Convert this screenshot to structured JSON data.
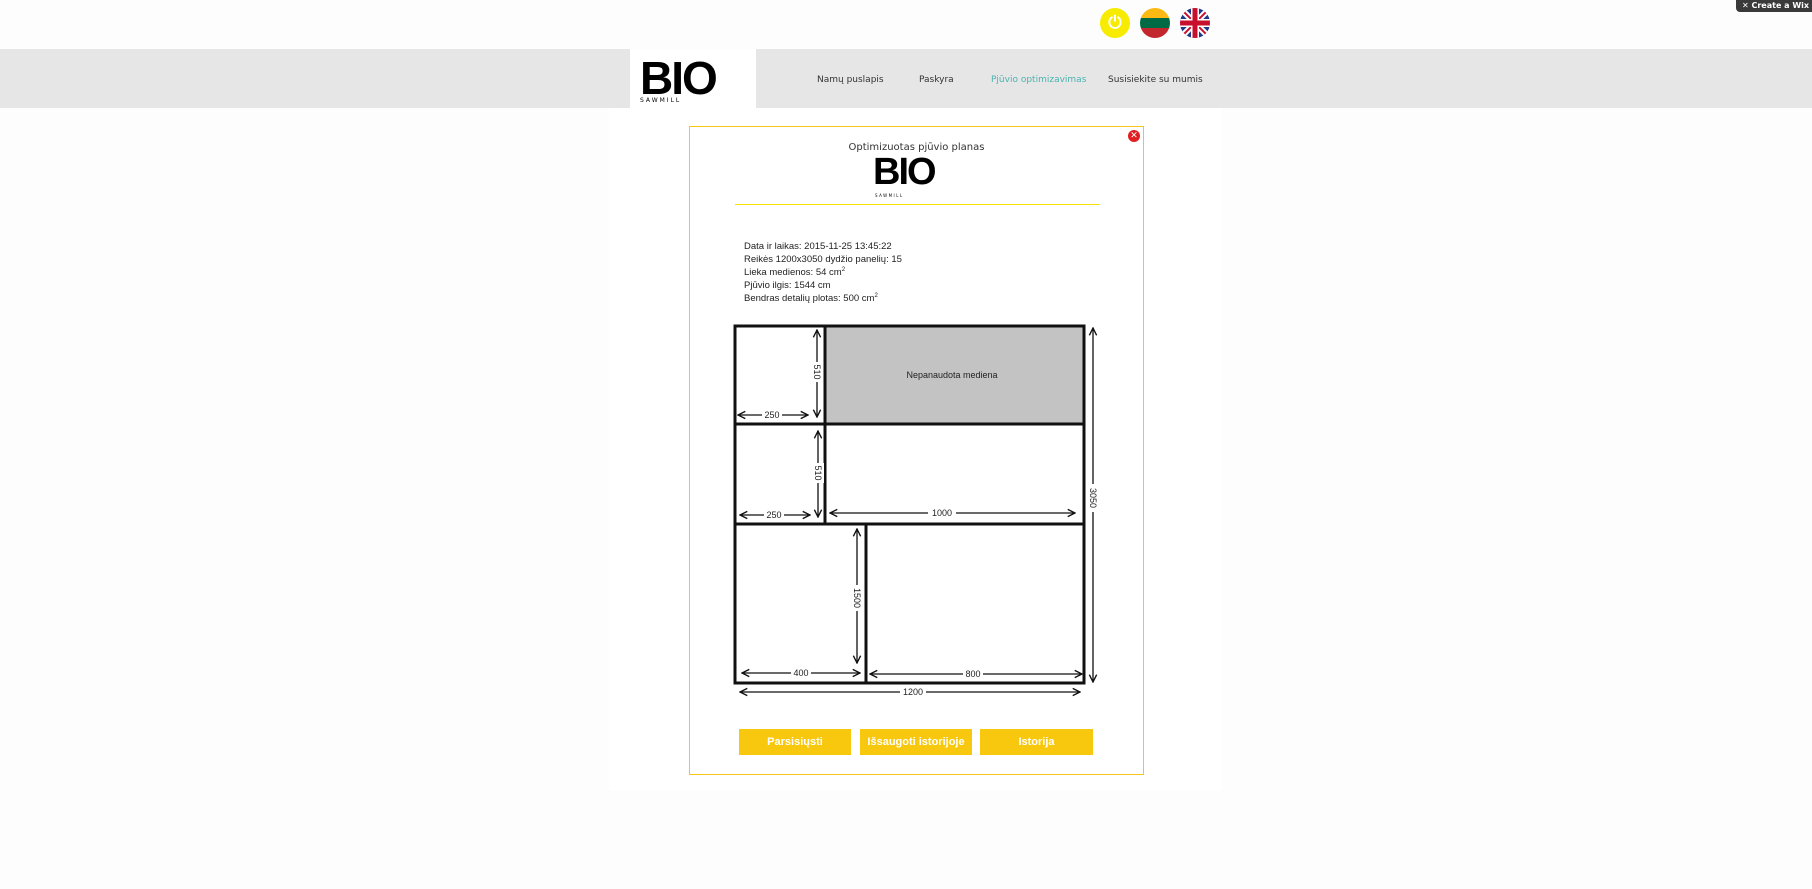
{
  "topbar": {
    "wix_label": "✕ Create a Wix",
    "icons": [
      "power-icon",
      "lithuania-flag-icon",
      "uk-flag-icon"
    ]
  },
  "logo": {
    "text": "BIO",
    "subtext": "SAWMILL"
  },
  "nav": [
    "Namų puslapis",
    "Paskyra",
    "Pjūvio optimizavimas",
    "Susisiekite su mumis"
  ],
  "modal": {
    "title": "Optimizuotas pjūvio planas",
    "info": [
      {
        "label": "Data ir laikas: 2015-11-25 13:45:22",
        "sup": ""
      },
      {
        "label": "Reikės 1200x3050 dydžio panelių:  15",
        "sup": ""
      },
      {
        "label": "Lieka medienos: 54 cm",
        "sup": "2"
      },
      {
        "label": "Pjūvio ilgis: 1544 cm",
        "sup": ""
      },
      {
        "label": "Bendras detalių plotas: 500 cm",
        "sup": "2"
      }
    ],
    "diagram": {
      "unused_label": "Nepanaudota mediena",
      "dims": {
        "w1": "250",
        "h1": "510",
        "w2": "250",
        "h2": "510",
        "w3": "1000",
        "h4": "1500",
        "w4": "400",
        "w5": "800",
        "total_w": "1200",
        "total_h": "3050"
      }
    },
    "buttons": [
      "Parsisiųsti",
      "Išsaugoti istorijoje",
      "Istorija"
    ]
  },
  "colors": {
    "accent": "#f8c80f",
    "nav_active": "#4bb3b0",
    "unused": "#c3c3c3"
  }
}
